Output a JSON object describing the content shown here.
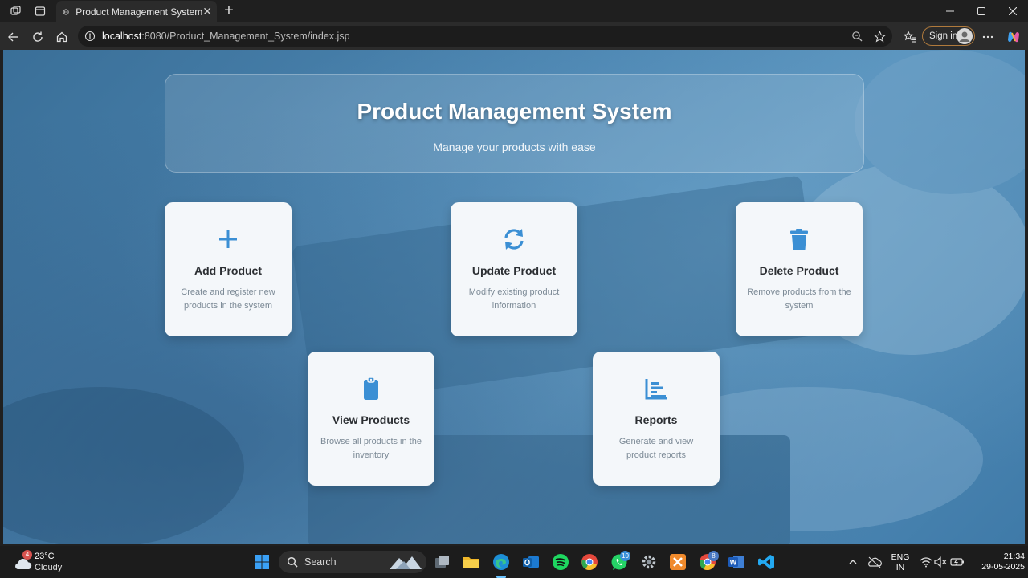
{
  "browser": {
    "tab_title": "Product Management System",
    "url_host": "localhost",
    "url_rest": ":8080/Product_Management_System/index.jsp",
    "signin_label": "Sign in"
  },
  "hero": {
    "title": "Product Management System",
    "subtitle": "Manage your products with ease"
  },
  "cards": [
    {
      "title": "Add Product",
      "description": "Create and register new products in the system",
      "icon": "plus-icon"
    },
    {
      "title": "Update Product",
      "description": "Modify existing product information",
      "icon": "refresh-icon"
    },
    {
      "title": "Delete Product",
      "description": "Remove products from the system",
      "icon": "trash-icon"
    },
    {
      "title": "View Products",
      "description": "Browse all products in the inventory",
      "icon": "clipboard-icon"
    },
    {
      "title": "Reports",
      "description": "Generate and view product reports",
      "icon": "bar-chart-icon"
    }
  ],
  "colors": {
    "accent": "#3b8fd4",
    "card_bg": "#f4f7fa"
  },
  "taskbar": {
    "weather_temp": "23°C",
    "weather_cond": "Cloudy",
    "weather_badge": "4",
    "search_label": "Search",
    "whatsapp_badge": "10",
    "chrome_badge": "8",
    "lang_line1": "ENG",
    "lang_line2": "IN",
    "time": "21:34",
    "date": "29-05-2025"
  }
}
